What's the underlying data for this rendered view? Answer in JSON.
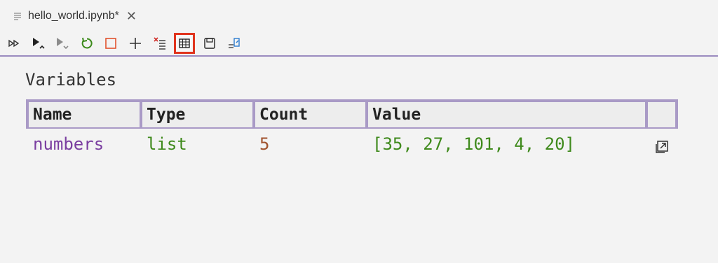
{
  "tab": {
    "title": "hello_world.ipynb*",
    "icon": "file-lines-icon",
    "close_label": "✕"
  },
  "toolbar": {
    "buttons": [
      {
        "name": "run-all",
        "icon": "double-play-icon"
      },
      {
        "name": "run-above",
        "icon": "play-up-icon"
      },
      {
        "name": "run-below",
        "icon": "play-down-icon"
      },
      {
        "name": "restart-kernel",
        "icon": "restart-icon"
      },
      {
        "name": "interrupt-kernel",
        "icon": "stop-square-icon"
      },
      {
        "name": "add-cell",
        "icon": "plus-icon"
      },
      {
        "name": "clear-outputs",
        "icon": "clear-outputs-icon"
      },
      {
        "name": "variables",
        "icon": "table-grid-icon",
        "active": true
      },
      {
        "name": "save",
        "icon": "floppy-icon"
      },
      {
        "name": "export",
        "icon": "export-icon"
      }
    ],
    "accent": "#e0341d"
  },
  "variables": {
    "heading": "Variables",
    "columns": [
      "Name",
      "Type",
      "Count",
      "Value",
      ""
    ],
    "rows": [
      {
        "name": "numbers",
        "type": "list",
        "count": "5",
        "value": "[35, 27, 101, 4, 20]",
        "action_icon": "open-external-icon"
      }
    ]
  },
  "colors": {
    "header_border": "#a99ac6",
    "name": "#7a3ea0",
    "type": "#3f8a1c",
    "count": "#a0522d",
    "value": "#3f8a1c"
  }
}
